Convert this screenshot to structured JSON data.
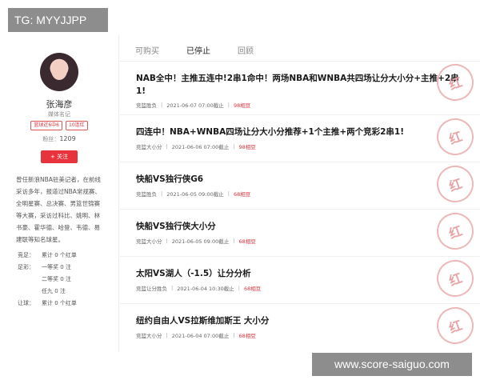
{
  "watermarks": {
    "top": "TG: MYYJJPP",
    "bottom": "www.score-saiguo.com"
  },
  "profile": {
    "name": "张海彦",
    "role": "媒体名记",
    "tags": [
      "篮球近6中6",
      "10连红"
    ],
    "fans_label": "粉丝：",
    "fans_count": "1209",
    "follow_label": "+ 关注",
    "bio": "曾任新浪NBA驻美记者，在前线采访多年，报道过NBA常规赛、全明星赛、总决赛、男篮世锦赛等大赛，采访过科比、姚明、林书豪、霍华德、哈登、韦德、易建联等知名球星。",
    "stats": [
      {
        "key": "竞足：",
        "value": "累计 0 个红单"
      },
      {
        "key": "足彩：",
        "value": "一等奖 0 注"
      },
      {
        "key": "",
        "value": "二等奖 0 注"
      },
      {
        "key": "",
        "value": "任九 0 注"
      },
      {
        "key": "让球：",
        "value": "累计 0 个红单"
      }
    ]
  },
  "tabs": [
    "可购买",
    "已停止",
    "回顾"
  ],
  "active_tab": "已停止",
  "articles": [
    {
      "title": "NAB全中！主推五连中!2串1命中！两场NBA和WNBA共四场让分大小分+主推+2串1!",
      "category": "竞篮胜负",
      "time": "2021-06-07 07:00截止",
      "price": "98相豆",
      "stamp": "红"
    },
    {
      "title": "四连中！NBA+WNBA四场让分大小分推荐+1个主推+两个竞彩2串1!",
      "category": "竞篮大小分",
      "time": "2021-06-06 07:00截止",
      "price": "98相豆",
      "stamp": "红"
    },
    {
      "title": "快船VS独行侠G6",
      "category": "竞篮胜负",
      "time": "2021-06-05 09:00截止",
      "price": "68相豆",
      "stamp": "红"
    },
    {
      "title": "快船VS独行侠大小分",
      "category": "竞篮大小分",
      "time": "2021-06-05 09:00截止",
      "price": "68相豆",
      "stamp": "红"
    },
    {
      "title": "太阳VS湖人（-1.5）让分分析",
      "category": "竞篮让分胜负",
      "time": "2021-06-04 10:30截止",
      "price": "68相豆",
      "stamp": "红"
    },
    {
      "title": "纽约自由人VS拉斯维加斯王 大小分",
      "category": "竞篮大小分",
      "time": "2021-06-04 07:00截止",
      "price": "68相豆",
      "stamp": "红"
    }
  ]
}
